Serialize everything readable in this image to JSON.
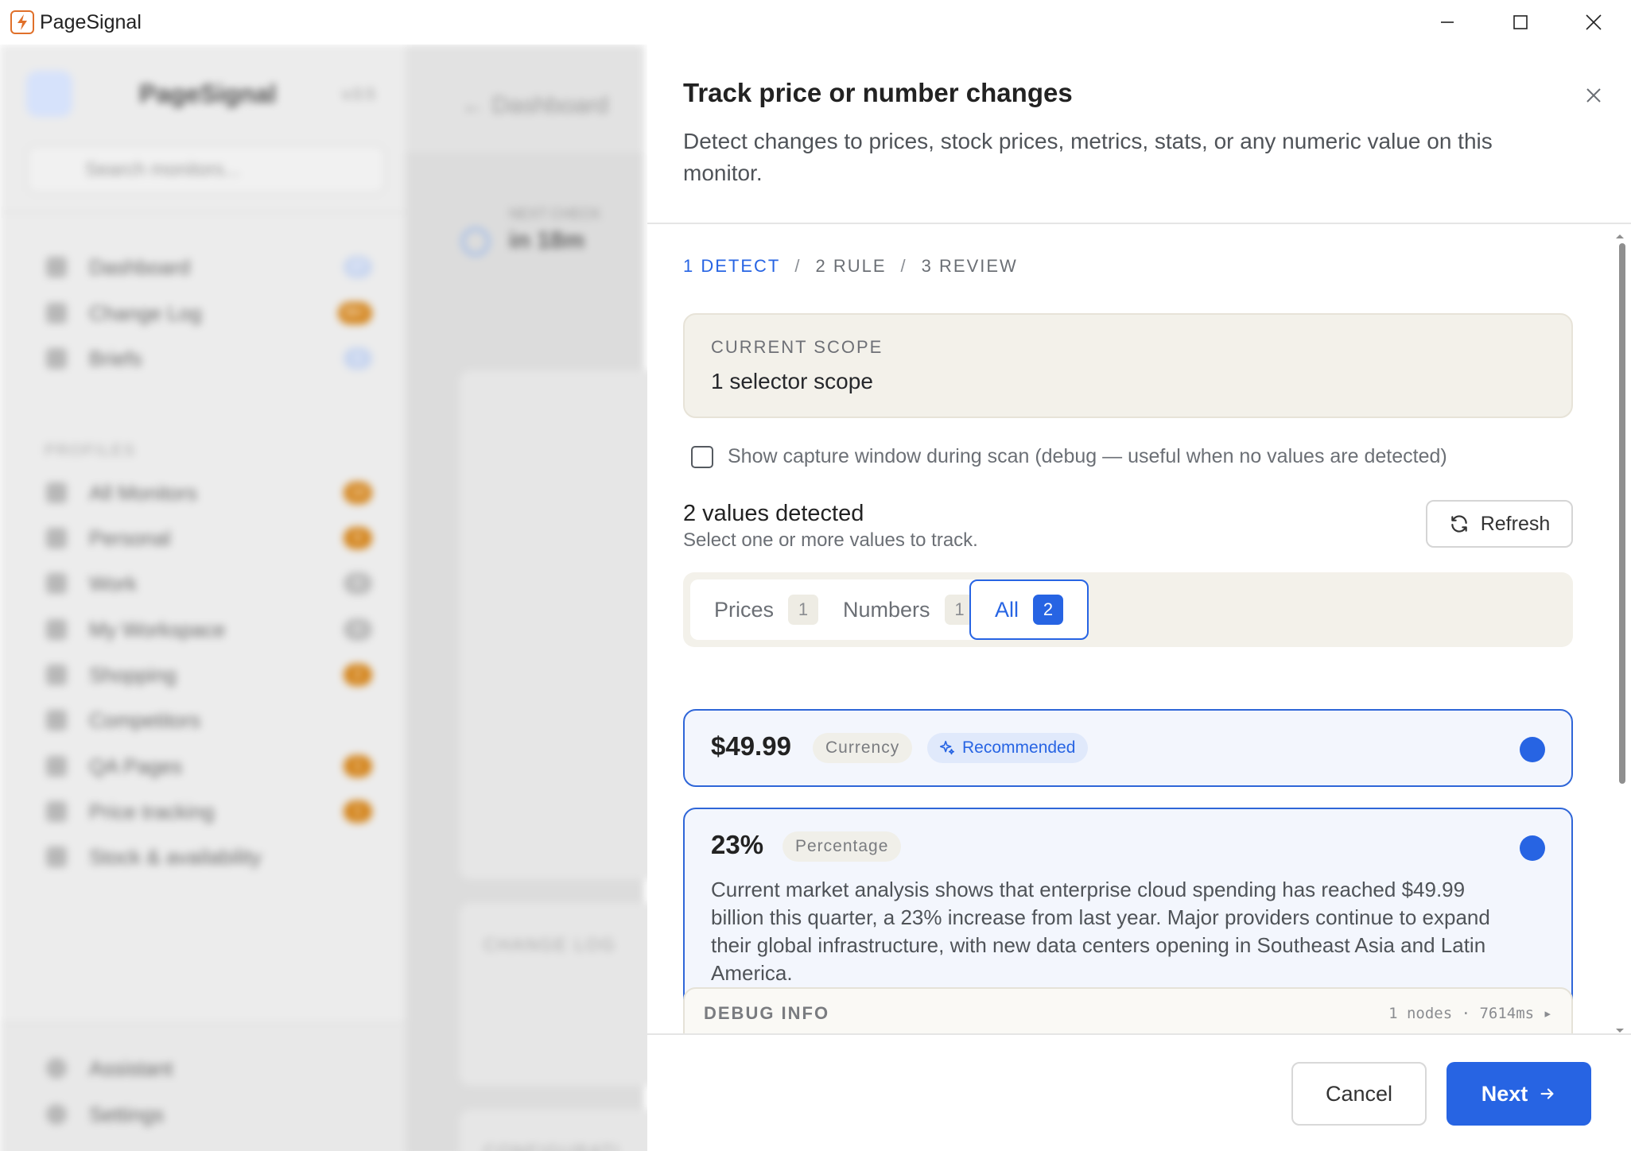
{
  "window": {
    "title": "PageSignal",
    "minimize_icon": "minimize-icon",
    "maximize_icon": "maximize-icon",
    "close_icon": "close-icon"
  },
  "background": {
    "app_name": "PageSignal",
    "version": "v.0.5",
    "search_placeholder": "Search monitors...",
    "search_shortcut": "/",
    "nav": [
      {
        "label": "Dashboard",
        "badge": "27"
      },
      {
        "label": "Change Log",
        "badge": "99+"
      },
      {
        "label": "Briefs",
        "badge": "1"
      }
    ],
    "profiles_label": "PROFILES",
    "profiles": [
      {
        "label": "All Monitors",
        "badge": "14"
      },
      {
        "label": "Personal",
        "badge": "0"
      },
      {
        "label": "Work",
        "badge": "0"
      },
      {
        "label": "My Workspace",
        "badge": "0"
      },
      {
        "label": "Shopping",
        "badge": "2"
      },
      {
        "label": "Competitors",
        "badge": ""
      },
      {
        "label": "QA Pages",
        "badge": "1"
      },
      {
        "label": "Price tracking",
        "badge": "1"
      },
      {
        "label": "Stock & availability",
        "badge": ""
      }
    ],
    "bottom_nav": [
      {
        "label": "Assistant"
      },
      {
        "label": "Settings"
      }
    ],
    "breadcrumb": "Dashboard",
    "next_check_label": "NEXT CHECK",
    "next_check_value": "in 18m",
    "change_log_label": "CHANGE LOG",
    "configuration_label": "CONFIGURATI"
  },
  "modal": {
    "title": "Track price or number changes",
    "subtitle": "Detect changes to prices, stock prices, metrics, stats, or any numeric value on this monitor.",
    "steps": [
      {
        "label": "1 DETECT",
        "active": true
      },
      {
        "label": "2 RULE",
        "active": false
      },
      {
        "label": "3 REVIEW",
        "active": false
      }
    ],
    "step_separator": "/",
    "scope": {
      "label": "CURRENT SCOPE",
      "value": "1 selector scope"
    },
    "debug_checkbox": {
      "label": "Show capture window during scan (debug — useful when no values are detected)",
      "checked": false
    },
    "values_detected": {
      "title": "2 values detected",
      "subtitle": "Select one or more values to track."
    },
    "refresh_label": "Refresh",
    "filters": [
      {
        "label": "Prices",
        "count": "1",
        "active": false
      },
      {
        "label": "Numbers",
        "count": "1",
        "active": false
      },
      {
        "label": "All",
        "count": "2",
        "active": true
      }
    ],
    "values": [
      {
        "value": "$49.99",
        "type": "Currency",
        "recommended": "Recommended",
        "selected": true,
        "context": ""
      },
      {
        "value": "23%",
        "type": "Percentage",
        "recommended": "",
        "selected": true,
        "context": "Current market analysis shows that enterprise cloud spending has reached $49.99 billion this quarter, a 23% increase from last year. Major providers continue to expand their global infrastructure, with new data centers opening in Southeast Asia and Latin America."
      }
    ],
    "debug_info": {
      "label": "DEBUG INFO",
      "meta": "1 nodes · 7614ms ▸"
    },
    "cancel_label": "Cancel",
    "next_label": "Next"
  },
  "colors": {
    "accent": "#2764e3",
    "scope_bg": "#f3f1ea",
    "badge_orange": "#d4861f"
  }
}
